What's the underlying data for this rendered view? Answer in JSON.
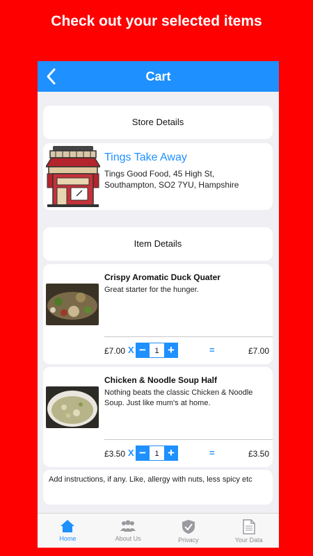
{
  "headline": "Check out your selected items",
  "navbar": {
    "title": "Cart",
    "back_icon": "chevron-left-icon"
  },
  "store_section": {
    "header": "Store Details"
  },
  "store": {
    "name": "Tings Take Away",
    "address": "Tings Good Food, 45 High St, Southampton, SO2 7YU, Hampshire"
  },
  "items_section": {
    "header": "Item Details"
  },
  "items": [
    {
      "name": "Crispy Aromatic Duck Quater",
      "description": "Great starter for the hunger.",
      "price": "£7.00",
      "times": "X",
      "minus": "−",
      "quantity": "1",
      "plus": "+",
      "equals": "=",
      "total": "£7.00"
    },
    {
      "name": "Chicken & Noodle Soup Half",
      "description": "Nothing beats the classic Chicken & Noodle Soup. Just like mum's at home.",
      "price": "£3.50",
      "times": "X",
      "minus": "−",
      "quantity": "1",
      "plus": "+",
      "equals": "=",
      "total": "£3.50"
    }
  ],
  "instructions": {
    "placeholder": "Add instructions, if any. Like, allergy with nuts, less spicy etc"
  },
  "tabs": [
    {
      "label": "Home",
      "icon": "home-icon",
      "active": true
    },
    {
      "label": "About Us",
      "icon": "people-icon",
      "active": false
    },
    {
      "label": "Privacy",
      "icon": "shield-check-icon",
      "active": false
    },
    {
      "label": "Your Data",
      "icon": "document-icon",
      "active": false
    }
  ],
  "colors": {
    "background": "#ff0000",
    "accent": "#1e90ff",
    "screen": "#efeff4"
  }
}
